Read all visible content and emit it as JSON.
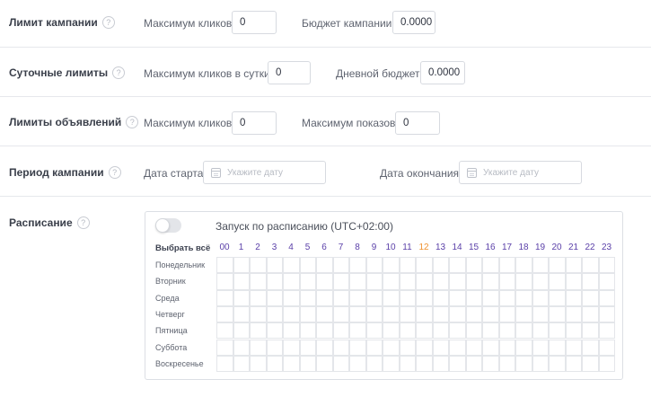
{
  "campaign_limit": {
    "title": "Лимит кампании",
    "max_clicks_label": "Максимум кликов",
    "max_clicks_value": "0",
    "budget_label": "Бюджет кампании",
    "budget_value": "0.0000"
  },
  "daily_limits": {
    "title": "Суточные лимиты",
    "max_clicks_label": "Максимум кликов в сутки",
    "max_clicks_value": "0",
    "budget_label": "Дневной бюджет",
    "budget_value": "0.0000"
  },
  "ad_limits": {
    "title": "Лимиты объявлений",
    "max_clicks_label": "Максимум кликов",
    "max_clicks_value": "0",
    "max_impressions_label": "Максимум показов",
    "max_impressions_value": "0"
  },
  "campaign_period": {
    "title": "Период кампании",
    "start_label": "Дата старта",
    "start_placeholder": "Укажите дату",
    "end_label": "Дата окончания",
    "end_placeholder": "Укажите дату"
  },
  "schedule": {
    "title": "Расписание",
    "toggle_label": "Запуск по расписанию (UTC+02:00)",
    "toggle_on": false,
    "select_all": "Выбрать всё",
    "hours": [
      "00",
      "1",
      "2",
      "3",
      "4",
      "5",
      "6",
      "7",
      "8",
      "9",
      "10",
      "11",
      "12",
      "13",
      "14",
      "15",
      "16",
      "17",
      "18",
      "19",
      "20",
      "21",
      "22",
      "23"
    ],
    "highlight_hour": "12",
    "days": [
      "Понедельник",
      "Вторник",
      "Среда",
      "Четверг",
      "Пятница",
      "Суббота",
      "Воскресенье"
    ]
  },
  "colors": {
    "hour_text": "#5a3fa8",
    "highlight_hour": "#f0922f",
    "divider": "#e6e8ec"
  },
  "icons": {
    "help": "question-circle-icon",
    "calendar": "calendar-icon"
  }
}
